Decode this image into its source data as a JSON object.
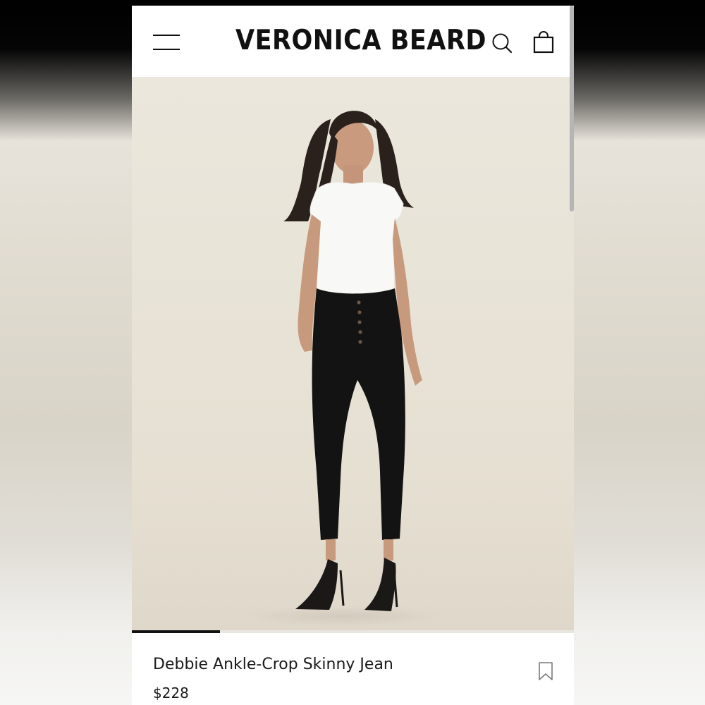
{
  "brand": {
    "logo_text": "VERONICA BEARD"
  },
  "header": {
    "icons": [
      "menu-icon",
      "search-icon",
      "shopping-bag-icon"
    ]
  },
  "gallery": {
    "image": "product-photo-model-white-tee-black-skinny-jeans",
    "progress": 0.2
  },
  "product": {
    "name": "Debbie Ankle-Crop Skinny Jean",
    "price": "$228",
    "save_icon": "bookmark-icon"
  },
  "colors": {
    "text": "#111111",
    "hero_background": "#e7e2d6",
    "progress_fill": "#111111"
  }
}
